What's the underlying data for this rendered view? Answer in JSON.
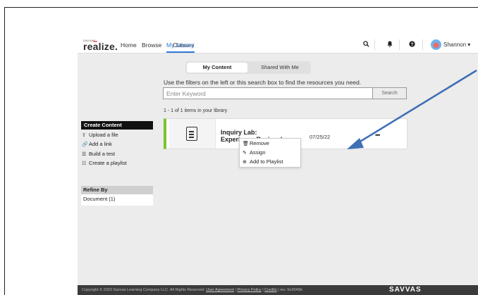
{
  "brand": {
    "small": "SAVVAS",
    "name": "realize."
  },
  "nav": {
    "home": "Home",
    "browse": "Browse",
    "classes": "Classes",
    "library": "My Library"
  },
  "user": {
    "name": "Shannon ▾"
  },
  "toggle": {
    "my_content": "My Content",
    "shared": "Shared With Me"
  },
  "hint": "Use the filters on the left or this search box to find the resources you need.",
  "search": {
    "placeholder": "Enter Keyword",
    "button": "Search"
  },
  "count": "1 - 1 of 1 items in your library",
  "create": {
    "title": "Create Content",
    "items": [
      {
        "icon": "⇧",
        "label": "Upload a file"
      },
      {
        "icon": "🔗",
        "label": "Add a link"
      },
      {
        "icon": "☰",
        "label": "Build a test"
      },
      {
        "icon": "☷",
        "label": "Create a playlist"
      }
    ]
  },
  "refine": {
    "title": "Refine By",
    "item": "Document (1)"
  },
  "card": {
    "title": "Inquiry Lab: Experience Revise d",
    "date": "07/25/22",
    "more": "•••"
  },
  "menu": {
    "items": [
      {
        "icon": "🗑",
        "label": "Remove"
      },
      {
        "icon": "✎",
        "label": "Assign"
      },
      {
        "icon": "⊕",
        "label": "Add to Playlist"
      }
    ]
  },
  "footer": {
    "copyright": "Copyright © 2020 Savvas Learning Company LLC. All Rights Reserved.",
    "user_agreement": "User Agreement",
    "privacy": "Privacy Policy",
    "credits": "Credits",
    "rev": "rev. 5e2049b",
    "logo": "SAVVAS"
  },
  "colors": {
    "accent": "#2d7ad6",
    "green": "#7cc32e",
    "arrow": "#3f6fb5"
  }
}
